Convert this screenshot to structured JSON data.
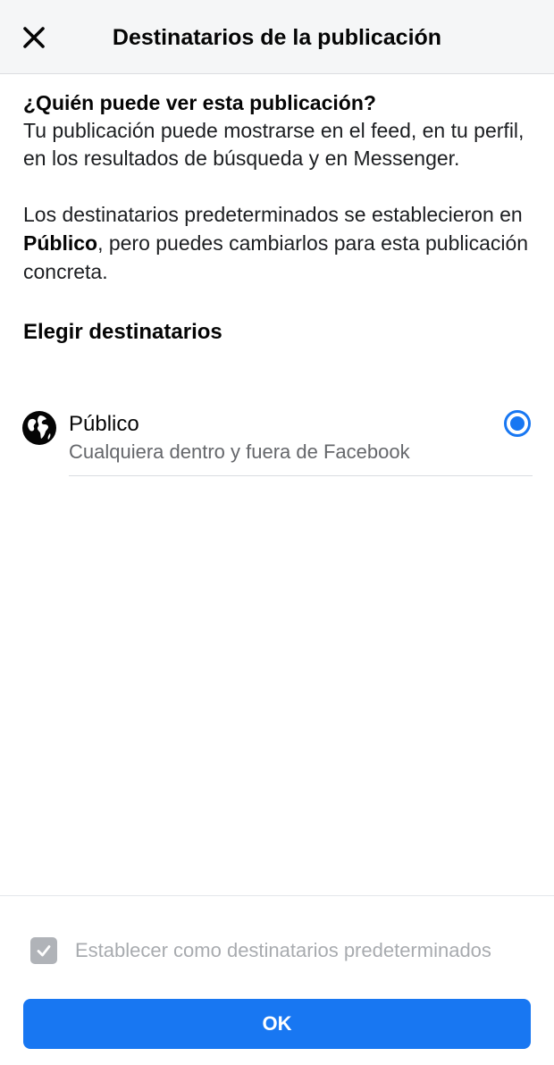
{
  "header": {
    "title": "Destinatarios de la publicación",
    "close_icon": "close-icon"
  },
  "intro": {
    "question": "¿Quién puede ver esta publicación?",
    "description": "Tu publicación puede mostrarse en el feed, en tu perfil, en los resultados de búsqueda y en Messenger.",
    "default_prefix": "Los destinatarios predeterminados se establecieron en ",
    "default_value": "Público",
    "default_suffix": ", pero puedes cambiarlos para esta publicación concreta."
  },
  "audience": {
    "section_title": "Elegir destinatarios",
    "options": [
      {
        "icon": "globe-icon",
        "label": "Público",
        "sublabel": "Cualquiera dentro y fuera de Facebook",
        "selected": true
      }
    ]
  },
  "footer": {
    "set_default_label": "Establecer como destinatarios predeterminados",
    "set_default_checked": true,
    "ok_label": "OK"
  },
  "colors": {
    "accent": "#1877f2",
    "header_bg": "#f5f6f7",
    "secondary_text": "#65676b",
    "disabled": "#b0b3b8"
  }
}
